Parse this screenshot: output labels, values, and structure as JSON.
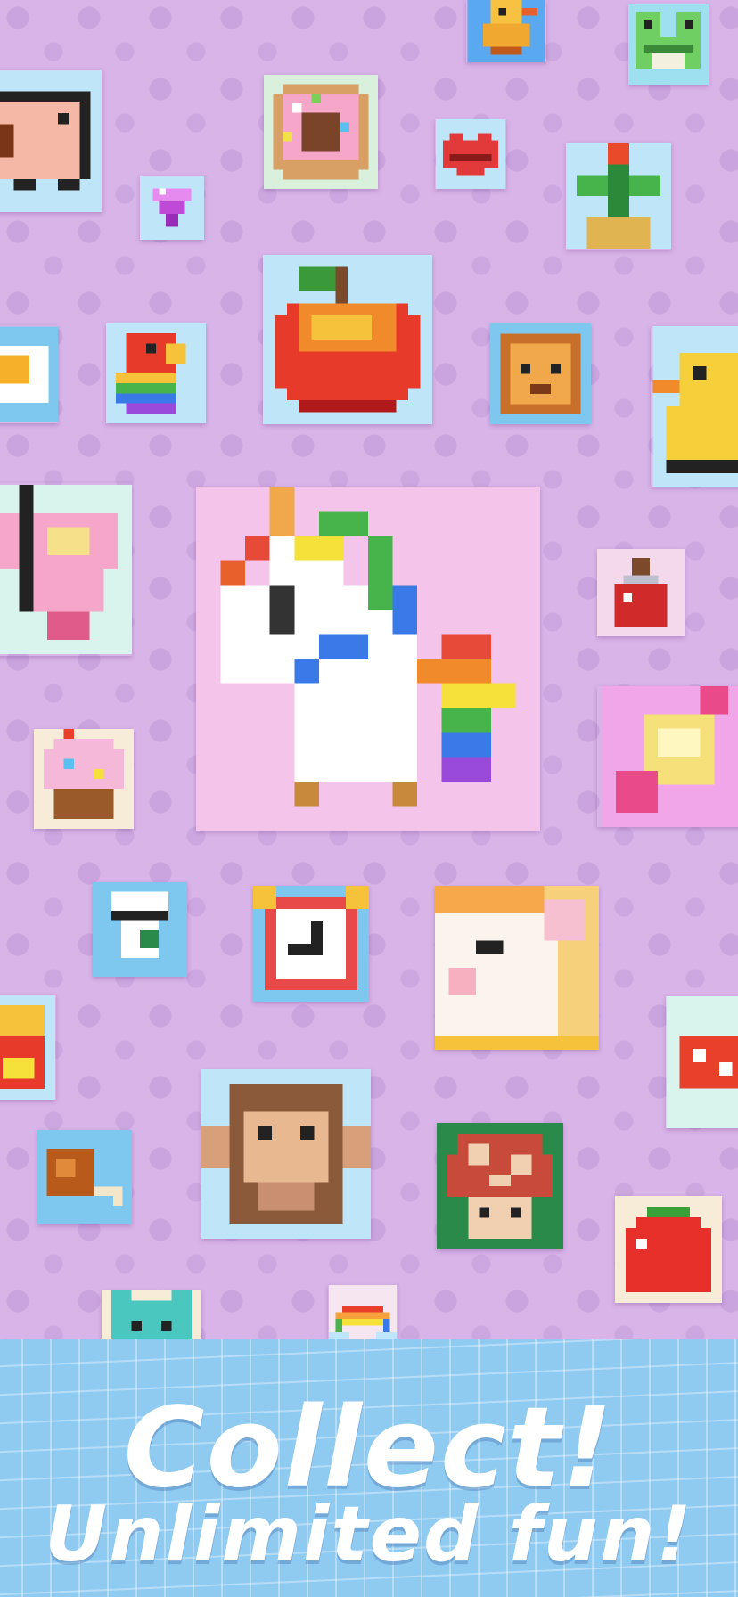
{
  "colors": {
    "background": "#d9b4e8",
    "banner": "#8fcaf1",
    "headline": "#ffffff"
  },
  "banner": {
    "line1": "Collect!",
    "line2": "Unlimited fun!"
  },
  "artworks": [
    {
      "name": "chick-art",
      "icon": "chick"
    },
    {
      "name": "frog-art",
      "icon": "frog"
    },
    {
      "name": "pig-art",
      "icon": "pig"
    },
    {
      "name": "donut-art",
      "icon": "donut"
    },
    {
      "name": "lips-art",
      "icon": "lips"
    },
    {
      "name": "flower-pot-art",
      "icon": "flower"
    },
    {
      "name": "diamond-art",
      "icon": "diamond"
    },
    {
      "name": "apple-art",
      "icon": "apple"
    },
    {
      "name": "fried-egg-art",
      "icon": "egg"
    },
    {
      "name": "parrot-art",
      "icon": "parrot"
    },
    {
      "name": "lion-art",
      "icon": "lion"
    },
    {
      "name": "duck-art",
      "icon": "duck"
    },
    {
      "name": "butterfly-art",
      "icon": "butterfly"
    },
    {
      "name": "unicorn-art",
      "icon": "unicorn"
    },
    {
      "name": "potion-art",
      "icon": "potion"
    },
    {
      "name": "candy-art",
      "icon": "candy"
    },
    {
      "name": "cupcake-art",
      "icon": "cupcake"
    },
    {
      "name": "drink-cup-art",
      "icon": "cup"
    },
    {
      "name": "alarm-clock-art",
      "icon": "clock"
    },
    {
      "name": "cat-art",
      "icon": "cat"
    },
    {
      "name": "fries-art",
      "icon": "fries"
    },
    {
      "name": "mushroom-small-art",
      "icon": "mushroom"
    },
    {
      "name": "monkey-art",
      "icon": "monkey"
    },
    {
      "name": "mushroom-art",
      "icon": "mushroom"
    },
    {
      "name": "chicken-leg-art",
      "icon": "drumstick"
    },
    {
      "name": "tomato-art",
      "icon": "tomato"
    },
    {
      "name": "teal-cat-art",
      "icon": "cat"
    },
    {
      "name": "rainbow-art",
      "icon": "rainbow"
    }
  ]
}
